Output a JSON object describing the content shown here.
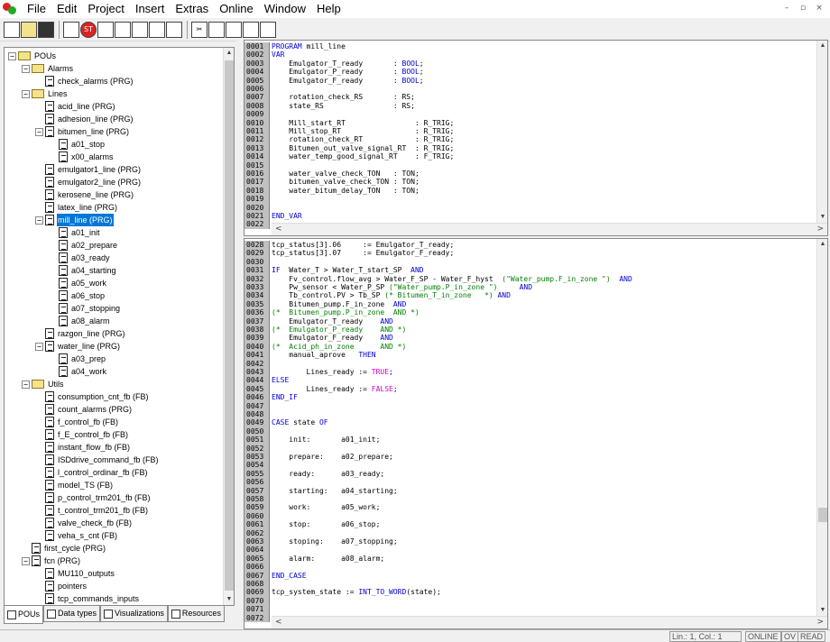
{
  "menu": [
    "File",
    "Edit",
    "Project",
    "Insert",
    "Extras",
    "Online",
    "Window",
    "Help"
  ],
  "window_buttons": [
    "–",
    "▫",
    "×"
  ],
  "toolbar_icons": [
    "new-file-icon",
    "open-folder-icon",
    "save-icon",
    "sep",
    "compile-icon",
    "stop-icon",
    "step-over-icon",
    "step-in-icon",
    "breakpoint-icon",
    "run-icon",
    "login-icon",
    "sep",
    "cut-icon",
    "copy-icon",
    "paste-icon",
    "find-icon",
    "replace-icon"
  ],
  "tree": [
    {
      "d": 0,
      "t": "folder",
      "pm": "-",
      "label": "POUs"
    },
    {
      "d": 1,
      "t": "folder",
      "pm": "-",
      "label": "Alarms"
    },
    {
      "d": 2,
      "t": "doc",
      "label": "check_alarms (PRG)"
    },
    {
      "d": 1,
      "t": "folder",
      "pm": "-",
      "label": "Lines"
    },
    {
      "d": 2,
      "t": "doc",
      "label": "acid_line (PRG)"
    },
    {
      "d": 2,
      "t": "doc",
      "label": "adhesion_line (PRG)"
    },
    {
      "d": 2,
      "t": "doc",
      "pm": "-",
      "label": "bitumen_line (PRG)"
    },
    {
      "d": 3,
      "t": "doc",
      "label": "a01_stop"
    },
    {
      "d": 3,
      "t": "doc",
      "label": "x00_alarms"
    },
    {
      "d": 2,
      "t": "doc",
      "label": "emulgator1_line (PRG)"
    },
    {
      "d": 2,
      "t": "doc",
      "label": "emulgator2_line (PRG)"
    },
    {
      "d": 2,
      "t": "doc",
      "label": "kerosene_line (PRG)"
    },
    {
      "d": 2,
      "t": "doc",
      "label": "latex_line (PRG)"
    },
    {
      "d": 2,
      "t": "doc",
      "pm": "-",
      "label": "mill_line (PRG)",
      "sel": true
    },
    {
      "d": 3,
      "t": "doc",
      "label": "a01_init"
    },
    {
      "d": 3,
      "t": "doc",
      "label": "a02_prepare"
    },
    {
      "d": 3,
      "t": "doc",
      "label": "a03_ready"
    },
    {
      "d": 3,
      "t": "doc",
      "label": "a04_starting"
    },
    {
      "d": 3,
      "t": "doc",
      "label": "a05_work"
    },
    {
      "d": 3,
      "t": "doc",
      "label": "a06_stop"
    },
    {
      "d": 3,
      "t": "doc",
      "label": "a07_stopping"
    },
    {
      "d": 3,
      "t": "doc",
      "label": "a08_alarm"
    },
    {
      "d": 2,
      "t": "doc",
      "label": "razgon_line (PRG)"
    },
    {
      "d": 2,
      "t": "doc",
      "pm": "-",
      "label": "water_line (PRG)"
    },
    {
      "d": 3,
      "t": "doc",
      "label": "a03_prep"
    },
    {
      "d": 3,
      "t": "doc",
      "label": "a04_work"
    },
    {
      "d": 1,
      "t": "folder",
      "pm": "-",
      "label": "Utils"
    },
    {
      "d": 2,
      "t": "doc",
      "label": "consumption_cnt_fb (FB)"
    },
    {
      "d": 2,
      "t": "doc",
      "label": "count_alarms (PRG)"
    },
    {
      "d": 2,
      "t": "doc",
      "label": "f_control_fb (FB)"
    },
    {
      "d": 2,
      "t": "doc",
      "label": "f_E_control_fb (FB)"
    },
    {
      "d": 2,
      "t": "doc",
      "label": "instant_flow_fb (FB)"
    },
    {
      "d": 2,
      "t": "doc",
      "label": "ISDdrive_command_fb (FB)"
    },
    {
      "d": 2,
      "t": "doc",
      "label": "l_control_ordinar_fb (FB)"
    },
    {
      "d": 2,
      "t": "doc",
      "label": "model_TS (FB)"
    },
    {
      "d": 2,
      "t": "doc",
      "label": "p_control_trm201_fb (FB)"
    },
    {
      "d": 2,
      "t": "doc",
      "label": "t_control_trm201_fb (FB)"
    },
    {
      "d": 2,
      "t": "doc",
      "label": "valve_check_fb (FB)"
    },
    {
      "d": 2,
      "t": "doc",
      "label": "veha_s_cnt (FB)"
    },
    {
      "d": 1,
      "t": "doc",
      "label": "first_cycle (PRG)"
    },
    {
      "d": 1,
      "t": "doc",
      "pm": "-",
      "label": "fcn (PRG)"
    },
    {
      "d": 2,
      "t": "doc",
      "label": "MU110_outputs"
    },
    {
      "d": 2,
      "t": "doc",
      "label": "pointers"
    },
    {
      "d": 2,
      "t": "doc",
      "label": "tcp_commands_inputs"
    }
  ],
  "tabs": [
    {
      "label": "POUs",
      "active": true
    },
    {
      "label": "Data types"
    },
    {
      "label": "Visualizations"
    },
    {
      "label": "Resources"
    }
  ],
  "decl_lines": [
    [
      "0001",
      [
        [
          "kw",
          "PROGRAM"
        ],
        [
          "n",
          " mill_line"
        ]
      ]
    ],
    [
      "0002",
      [
        [
          "kw",
          "VAR"
        ]
      ]
    ],
    [
      "0003",
      [
        [
          "n",
          "    Emulgator_T_ready       : "
        ],
        [
          "kw",
          "BOOL"
        ],
        [
          "n",
          ";"
        ]
      ]
    ],
    [
      "0004",
      [
        [
          "n",
          "    Emulgator_P_ready       : "
        ],
        [
          "kw",
          "BOOL"
        ],
        [
          "n",
          ";"
        ]
      ]
    ],
    [
      "0005",
      [
        [
          "n",
          "    Emulgator_F_ready       : "
        ],
        [
          "kw",
          "BOOL"
        ],
        [
          "n",
          ";"
        ]
      ]
    ],
    [
      "0006",
      [
        [
          "n",
          ""
        ]
      ]
    ],
    [
      "0007",
      [
        [
          "n",
          "    rotation_check_RS       : RS;"
        ]
      ]
    ],
    [
      "0008",
      [
        [
          "n",
          "    state_RS                : RS;"
        ]
      ]
    ],
    [
      "0009",
      [
        [
          "n",
          ""
        ]
      ]
    ],
    [
      "0010",
      [
        [
          "n",
          "    Mill_start_RT                : R_TRIG;"
        ]
      ]
    ],
    [
      "0011",
      [
        [
          "n",
          "    Mill_stop_RT                 : R_TRIG;"
        ]
      ]
    ],
    [
      "0012",
      [
        [
          "n",
          "    rotation_check_RT            : R_TRIG;"
        ]
      ]
    ],
    [
      "0013",
      [
        [
          "n",
          "    Bitumen_out_valve_signal_RT  : R_TRIG;"
        ]
      ]
    ],
    [
      "0014",
      [
        [
          "n",
          "    water_temp_good_signal_RT    : F_TRIG;"
        ]
      ]
    ],
    [
      "0015",
      [
        [
          "n",
          ""
        ]
      ]
    ],
    [
      "0016",
      [
        [
          "n",
          "    water_valve_check_TON   : TON;"
        ]
      ]
    ],
    [
      "0017",
      [
        [
          "n",
          "    bitumen_valve_check_TON : TON;"
        ]
      ]
    ],
    [
      "0018",
      [
        [
          "n",
          "    water_bitum_delay_TON   : TON;"
        ]
      ]
    ],
    [
      "0019",
      [
        [
          "n",
          ""
        ]
      ]
    ],
    [
      "0020",
      [
        [
          "n",
          ""
        ]
      ]
    ],
    [
      "0021",
      [
        [
          "kw",
          "END_VAR"
        ]
      ]
    ],
    [
      "0022",
      [
        [
          "n",
          ""
        ]
      ]
    ]
  ],
  "body_lines": [
    [
      "0028",
      [
        [
          "n",
          "tcp_status[3].06     := Emulgator_T_ready;"
        ]
      ]
    ],
    [
      "0029",
      [
        [
          "n",
          "tcp_status[3].07     := Emulgator_F_ready;"
        ]
      ]
    ],
    [
      "0030",
      [
        [
          "n",
          ""
        ]
      ]
    ],
    [
      "0031",
      [
        [
          "kw",
          "IF"
        ],
        [
          "n",
          "  Water_T > Water_T_start_SP  "
        ],
        [
          "kw",
          "AND"
        ]
      ]
    ],
    [
      "0032",
      [
        [
          "n",
          "    Fv_control.flow_avg > Water_F_SP - Water_F_hyst  "
        ],
        [
          "cm",
          "(\"Water_pump.F_in_zone \")"
        ],
        [
          "n",
          "  "
        ],
        [
          "kw",
          "AND"
        ]
      ]
    ],
    [
      "0033",
      [
        [
          "n",
          "    Pw_sensor < Water_P_SP "
        ],
        [
          "cm",
          "(\"Water_pump.P_in_zone \")"
        ],
        [
          "n",
          "     "
        ],
        [
          "kw",
          "AND"
        ]
      ]
    ],
    [
      "0034",
      [
        [
          "n",
          "    Tb_control.PV > Tb_SP "
        ],
        [
          "cm",
          "(* Bitumen_T_in_zone   *)"
        ],
        [
          "n",
          " "
        ],
        [
          "kw",
          "AND"
        ]
      ]
    ],
    [
      "0035",
      [
        [
          "n",
          "    Bitumen_pump.F_in_zone  "
        ],
        [
          "kw",
          "AND"
        ]
      ]
    ],
    [
      "0036",
      [
        [
          "cm",
          "(*  Bitumen_pump.P_in_zone  AND *)"
        ]
      ]
    ],
    [
      "0037",
      [
        [
          "n",
          "    Emulgator_T_ready    "
        ],
        [
          "kw",
          "AND"
        ]
      ]
    ],
    [
      "0038",
      [
        [
          "cm",
          "(*  Emulgator_P_ready    AND *)"
        ]
      ]
    ],
    [
      "0039",
      [
        [
          "n",
          "    Emulgator_F_ready    "
        ],
        [
          "kw",
          "AND"
        ]
      ]
    ],
    [
      "0040",
      [
        [
          "cm",
          "(*  Acid_ph_in_zone      AND *)"
        ]
      ]
    ],
    [
      "0041",
      [
        [
          "n",
          "    manual_aprove   "
        ],
        [
          "kw",
          "THEN"
        ]
      ]
    ],
    [
      "0042",
      [
        [
          "n",
          ""
        ]
      ]
    ],
    [
      "0043",
      [
        [
          "n",
          "        Lines_ready := "
        ],
        [
          "mg",
          "TRUE"
        ],
        [
          "n",
          ";"
        ]
      ]
    ],
    [
      "0044",
      [
        [
          "kw",
          "ELSE"
        ]
      ]
    ],
    [
      "0045",
      [
        [
          "n",
          "        Lines_ready := "
        ],
        [
          "mg",
          "FALSE"
        ],
        [
          "n",
          ";"
        ]
      ]
    ],
    [
      "0046",
      [
        [
          "kw",
          "END_IF"
        ]
      ]
    ],
    [
      "0047",
      [
        [
          "n",
          ""
        ]
      ]
    ],
    [
      "0048",
      [
        [
          "n",
          ""
        ]
      ]
    ],
    [
      "0049",
      [
        [
          "kw",
          "CASE"
        ],
        [
          "n",
          " state "
        ],
        [
          "kw",
          "OF"
        ]
      ]
    ],
    [
      "0050",
      [
        [
          "n",
          ""
        ]
      ]
    ],
    [
      "0051",
      [
        [
          "n",
          "    init:       a01_init;"
        ]
      ]
    ],
    [
      "0052",
      [
        [
          "n",
          ""
        ]
      ]
    ],
    [
      "0053",
      [
        [
          "n",
          "    prepare:    a02_prepare;"
        ]
      ]
    ],
    [
      "0054",
      [
        [
          "n",
          ""
        ]
      ]
    ],
    [
      "0055",
      [
        [
          "n",
          "    ready:      a03_ready;"
        ]
      ]
    ],
    [
      "0056",
      [
        [
          "n",
          ""
        ]
      ]
    ],
    [
      "0057",
      [
        [
          "n",
          "    starting:   a04_starting;"
        ]
      ]
    ],
    [
      "0058",
      [
        [
          "n",
          ""
        ]
      ]
    ],
    [
      "0059",
      [
        [
          "n",
          "    work:       a05_work;"
        ]
      ]
    ],
    [
      "0060",
      [
        [
          "n",
          ""
        ]
      ]
    ],
    [
      "0061",
      [
        [
          "n",
          "    stop:       a06_stop;"
        ]
      ]
    ],
    [
      "0062",
      [
        [
          "n",
          ""
        ]
      ]
    ],
    [
      "0063",
      [
        [
          "n",
          "    stoping:    a07_stopping;"
        ]
      ]
    ],
    [
      "0064",
      [
        [
          "n",
          ""
        ]
      ]
    ],
    [
      "0065",
      [
        [
          "n",
          "    alarm:      a08_alarm;"
        ]
      ]
    ],
    [
      "0066",
      [
        [
          "n",
          ""
        ]
      ]
    ],
    [
      "0067",
      [
        [
          "kw",
          "END_CASE"
        ]
      ]
    ],
    [
      "0068",
      [
        [
          "n",
          ""
        ]
      ]
    ],
    [
      "0069",
      [
        [
          "n",
          "tcp_system_state := "
        ],
        [
          "kw",
          "INT_TO_WORD"
        ],
        [
          "n",
          "(state);"
        ]
      ]
    ],
    [
      "0070",
      [
        [
          "n",
          ""
        ]
      ]
    ],
    [
      "0071",
      [
        [
          "n",
          ""
        ]
      ]
    ],
    [
      "0072",
      [
        [
          "n",
          ""
        ]
      ]
    ]
  ],
  "status": {
    "position": "Lin.: 1, Col.: 1",
    "online": "ONLINE",
    "ov": "OV",
    "read": "READ"
  }
}
